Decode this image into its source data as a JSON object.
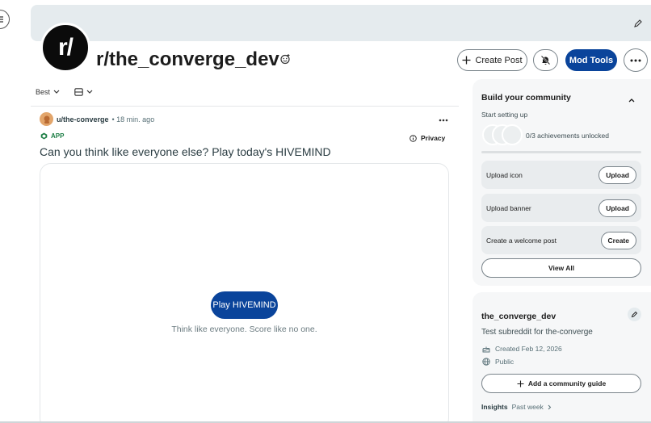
{
  "header": {
    "subreddit_name": "r/the_converge_dev",
    "avatar_text": "r/",
    "create_post_label": "Create Post",
    "mod_tools_label": "Mod Tools"
  },
  "feed": {
    "sort_label": "Best",
    "post": {
      "author": "u/the-converge",
      "time": "• 18 min. ago",
      "app_label": "APP",
      "privacy_label": "Privacy",
      "title": "Can you think like everyone else? Play today's HIVEMIND",
      "play_label": "Play HIVEMIND",
      "tagline": "Think like everyone. Score like no one."
    }
  },
  "sidebar": {
    "build_card": {
      "title": "Build your community",
      "subtitle": "Start setting up",
      "achievements_text": "0/3 achievements unlocked",
      "tasks": [
        {
          "label": "Upload icon",
          "button": "Upload"
        },
        {
          "label": "Upload banner",
          "button": "Upload"
        },
        {
          "label": "Create a welcome post",
          "button": "Create"
        }
      ],
      "view_all_label": "View All"
    },
    "about_card": {
      "name": "the_converge_dev",
      "description": "Test subreddit for the-converge",
      "created": "Created Feb 12, 2026",
      "visibility": "Public",
      "guide_label": "Add a community guide",
      "insights_label": "Insights",
      "insights_period": "Past week"
    }
  },
  "colors": {
    "primary_blue": "#0a449b",
    "banner_bg": "#e5ebee",
    "card_bg": "#f6f7f8",
    "app_green": "#1b7d44"
  }
}
